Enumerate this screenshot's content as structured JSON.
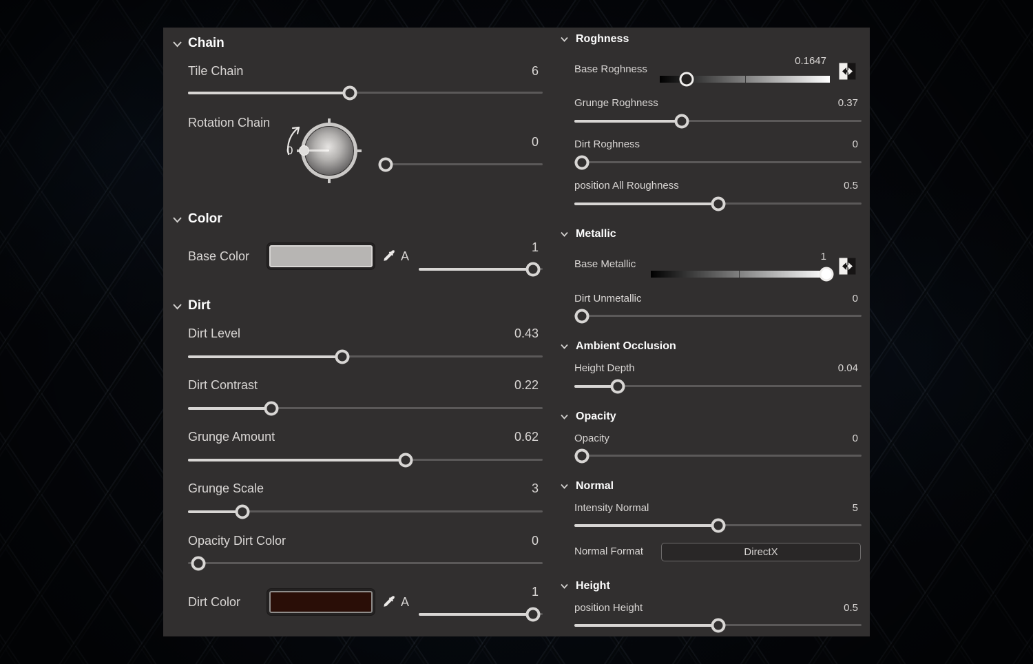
{
  "left": {
    "chain": {
      "title": "Chain",
      "tile_chain": {
        "label": "Tile Chain",
        "value": "6"
      },
      "rotation_chain": {
        "label": "Rotation Chain",
        "value": "0",
        "dial_value": "0"
      }
    },
    "color": {
      "title": "Color",
      "base_color": {
        "label": "Base Color",
        "alpha_label": "A",
        "alpha_value": "1",
        "swatch_color": "#b7b5b3"
      }
    },
    "dirt": {
      "title": "Dirt",
      "dirt_level": {
        "label": "Dirt Level",
        "value": "0.43"
      },
      "dirt_contrast": {
        "label": "Dirt Contrast",
        "value": "0.22"
      },
      "grunge_amount": {
        "label": "Grunge Amount",
        "value": "0.62"
      },
      "grunge_scale": {
        "label": "Grunge Scale",
        "value": "3"
      },
      "opacity_dirt_color": {
        "label": "Opacity Dirt Color",
        "value": "0"
      },
      "dirt_color": {
        "label": "Dirt Color",
        "alpha_label": "A",
        "alpha_value": "1",
        "swatch_color": "#2a0e07"
      }
    }
  },
  "right": {
    "roghness": {
      "title": "Roghness",
      "base_roghness": {
        "label": "Base Roghness",
        "value": "0.1647"
      },
      "grunge_roghness": {
        "label": "Grunge Roghness",
        "value": "0.37"
      },
      "dirt_roghness": {
        "label": "Dirt Roghness",
        "value": "0"
      },
      "position_all_roughness": {
        "label": "position All Roughness",
        "value": "0.5"
      }
    },
    "metallic": {
      "title": "Metallic",
      "base_metallic": {
        "label": "Base Metallic",
        "value": "1"
      },
      "dirt_unmetallic": {
        "label": "Dirt Unmetallic",
        "value": "0"
      }
    },
    "ambient_occlusion": {
      "title": "Ambient Occlusion",
      "height_depth": {
        "label": "Height Depth",
        "value": "0.04"
      }
    },
    "opacity": {
      "title": "Opacity",
      "opacity": {
        "label": "Opacity",
        "value": "0"
      }
    },
    "normal": {
      "title": "Normal",
      "intensity_normal": {
        "label": "Intensity Normal",
        "value": "5"
      },
      "normal_format": {
        "label": "Normal Format",
        "value": "DirectX"
      }
    },
    "height": {
      "title": "Height",
      "position_height": {
        "label": "position Height",
        "value": "0.5"
      }
    }
  },
  "icons": {
    "collapse": "chevron-down",
    "color_picker": "eyedropper",
    "invert": "split-left-right-arrows",
    "rotation": "rotation-dial"
  },
  "colors": {
    "panel_bg": "#312f2f",
    "text": "#d9d6d4",
    "header_text": "#fcfcfc",
    "track": "#5b5959",
    "track_fill": "#d8d6d4",
    "base_color_swatch": "#b7b5b3",
    "dirt_color_swatch": "#2a0e07",
    "dropdown_border": "#6e6c6c"
  }
}
